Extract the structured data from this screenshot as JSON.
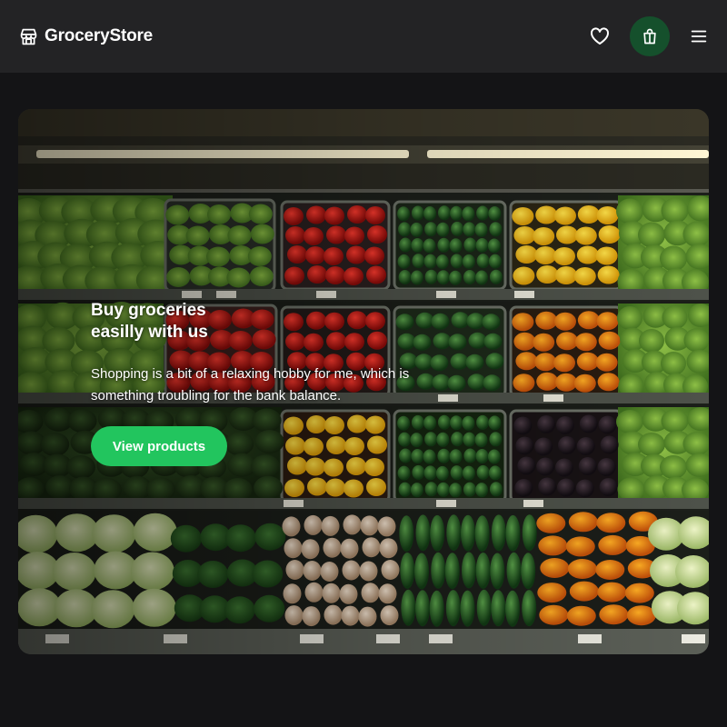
{
  "header": {
    "brand": "GroceryStore",
    "icons": {
      "logo": "storefront-icon",
      "favorites": "heart-icon",
      "cart": "shopping-bag-icon",
      "menu": "hamburger-menu-icon"
    }
  },
  "hero": {
    "title": "Buy groceries easilly with us",
    "description": "Shopping is a bit of a relaxing hobby for me, which is something troubling for the bank balance.",
    "cta_label": "View products",
    "image": "supermarket-produce-shelves-photo"
  },
  "colors": {
    "page_bg": "#141416",
    "header_bg": "#232325",
    "accent": "#22c55e",
    "cart_bg": "#15502c"
  }
}
